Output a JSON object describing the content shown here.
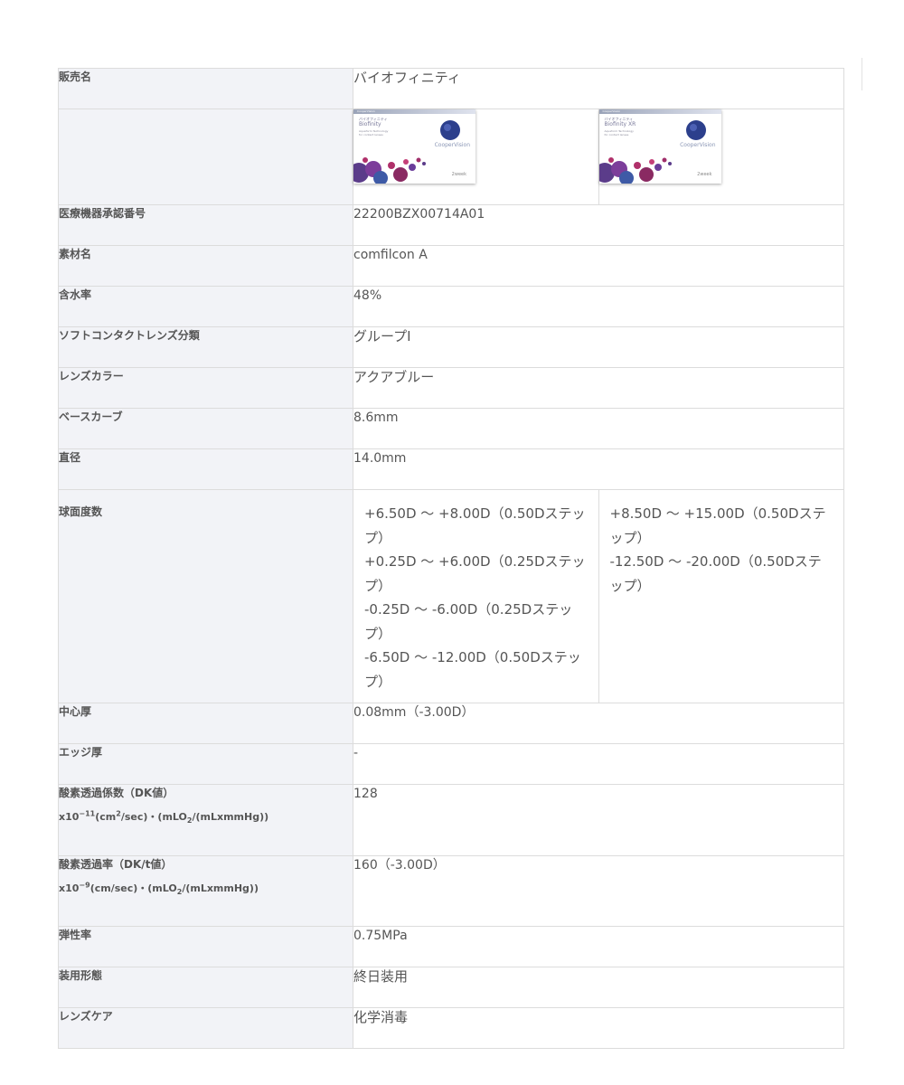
{
  "rows": [
    {
      "label": "販売名",
      "value": "バイオフィニティ"
    },
    {
      "label": "",
      "products": [
        {
          "kana": "バイオフィニティ",
          "brand": "Biofinity",
          "top": "CooperVision",
          "tag": "Aquaform Technology",
          "tag2": "for contact lenses",
          "logo": "CooperVision",
          "week": "2week"
        },
        {
          "kana": "バイオフィニティ",
          "brand": "Biofinity XR",
          "top": "CooperVision",
          "tag": "Aquaform Technology",
          "tag2": "for contact lenses",
          "logo": "CooperVision",
          "week": "2week"
        }
      ]
    },
    {
      "label": "医療機器承認番号",
      "value": "22200BZX00714A01"
    },
    {
      "label": "素材名",
      "value": "comfilcon A"
    },
    {
      "label": "含水率",
      "value": "48%"
    },
    {
      "label": "ソフトコンタクトレンズ分類",
      "value": "グループⅠ"
    },
    {
      "label": "レンズカラー",
      "value": "アクアブルー"
    },
    {
      "label": "ベースカーブ",
      "value": "8.6mm"
    },
    {
      "label": "直径",
      "value": "14.0mm"
    },
    {
      "label": "球面度数",
      "left": [
        "+6.50D 〜 +8.00D（0.50Dステップ）",
        "+0.25D 〜 +6.00D（0.25Dステップ）",
        "-0.25D 〜 -6.00D（0.25Dステップ）",
        "-6.50D 〜 -12.00D（0.50Dステップ）"
      ],
      "right": [
        "+8.50D 〜 +15.00D（0.50Dステップ）",
        "-12.50D 〜 -20.00D（0.50Dステップ）"
      ]
    },
    {
      "label": "中心厚",
      "value": "0.08mm（-3.00D）"
    },
    {
      "label": "エッジ厚",
      "value": "-"
    },
    {
      "label": "酸素透過係数（DK値）",
      "sub": {
        "a": "x10",
        "exp": "−11",
        "b": "(cm",
        "sq": "2",
        "c": "/sec)・(mLO",
        "o2": "2",
        "d": "/(mLxmmHg))"
      },
      "value": "128"
    },
    {
      "label": "酸素透過率（DK/t値）",
      "sub": {
        "a": "x10",
        "exp": "−9",
        "c": "(cm/sec)・(mLO",
        "o2": "2",
        "d": "/(mLxmmHg))"
      },
      "value": "160（-3.00D）"
    },
    {
      "label": "弾性率",
      "value": "0.75MPa"
    },
    {
      "label": "装用形態",
      "value": "終日装用"
    },
    {
      "label": "レンズケア",
      "value": "化学消毒"
    }
  ]
}
